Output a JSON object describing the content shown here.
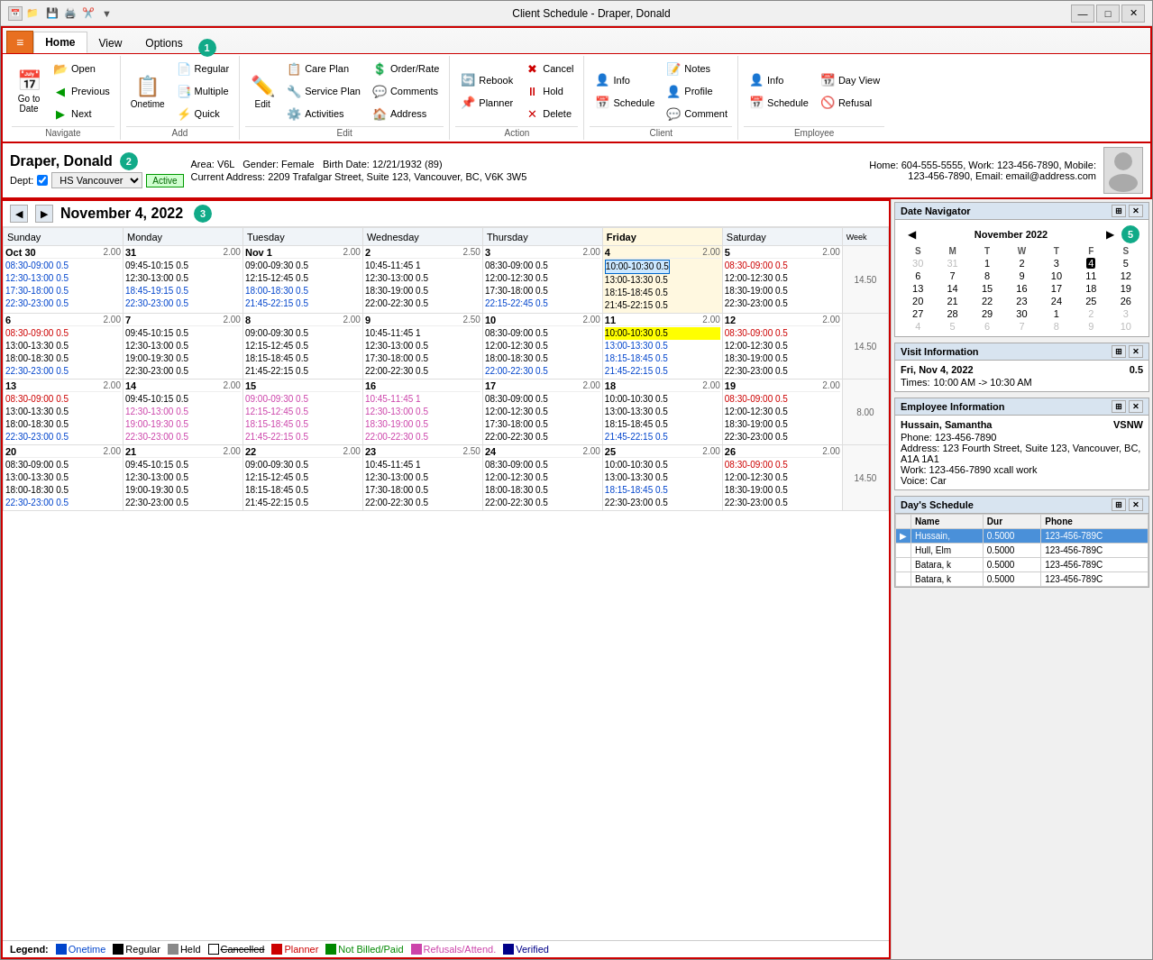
{
  "window": {
    "title": "Client Schedule - Draper, Donald",
    "min_label": "—",
    "max_label": "□",
    "close_label": "✕"
  },
  "quickaccess": {
    "icons": [
      "📁",
      "💾",
      "🖨️",
      "✂️"
    ]
  },
  "ribbon": {
    "tabs": [
      "Home",
      "View",
      "Options"
    ],
    "active_tab_icon": "≡",
    "groups": {
      "navigate": {
        "label": "Navigate",
        "goto_label": "Go to\nDate",
        "open_label": "Open",
        "prev_label": "Previous",
        "next_label": "Next"
      },
      "add": {
        "label": "Add",
        "onetime_label": "Onetime",
        "regular_label": "Regular",
        "multiple_label": "Multiple",
        "quick_label": "Quick"
      },
      "edit": {
        "label": "Edit",
        "edit_label": "Edit",
        "care_plan_label": "Care Plan",
        "service_plan_label": "Service Plan",
        "activities_label": "Activities",
        "order_rate_label": "Order/Rate",
        "comments_label": "Comments",
        "address_label": "Address"
      },
      "action": {
        "label": "Action",
        "rebook_label": "Rebook",
        "planner_label": "Planner",
        "cancel_label": "Cancel",
        "hold_label": "Hold",
        "delete_label": "Delete"
      },
      "client": {
        "label": "Client",
        "info_label": "Info",
        "schedule_label": "Schedule",
        "notes_label": "Notes",
        "profile_label": "Profile",
        "comment_label": "Comment"
      },
      "employee": {
        "label": "Employee",
        "info_label": "Info",
        "schedule_label": "Schedule",
        "day_view_label": "Day View",
        "refusal_label": "Refusal"
      }
    }
  },
  "client": {
    "name": "Draper, Donald",
    "area": "Area: V6L",
    "gender": "Gender: Female",
    "birth_date": "Birth Date: 12/21/1932 (89)",
    "address": "Current Address: 2209 Trafalgar Street, Suite 123, Vancouver, BC, V6K 3W5",
    "home_phone": "Home: 604-555-5555, Work: 123-456-7890, Mobile: 123-456-7890, Email: email@address.com",
    "dept_label": "Dept:",
    "dept_value": "HS Vancouver",
    "status": "Active"
  },
  "calendar": {
    "title": "November 4, 2022",
    "badge_num": "3",
    "days_of_week": [
      "Sunday",
      "Monday",
      "Tuesday",
      "Wednesday",
      "Thursday",
      "Friday",
      "Saturday"
    ],
    "week_col": "Week",
    "weeks": [
      {
        "week_total": "14.50",
        "days": [
          {
            "num": "Oct 30",
            "total": "2.00",
            "entries": [
              "08:30-09:00 0.5",
              "12:30-13:00 0.5",
              "17:30-18:00 0.5",
              "22:30-23:00 0.5"
            ],
            "colors": [
              "blue",
              "blue",
              "blue",
              "blue"
            ]
          },
          {
            "num": "31",
            "total": "2.00",
            "entries": [
              "09:45-10:15 0.5",
              "12:30-13:00 0.5",
              "18:45-19:15 0.5",
              "22:30-23:00 0.5"
            ],
            "colors": [
              "black",
              "black",
              "blue",
              "blue"
            ]
          },
          {
            "num": "Nov 1",
            "total": "2.00",
            "entries": [
              "09:00-09:30 0.5",
              "12:15-12:45 0.5",
              "18:00-18:30 0.5",
              "21:45-22:15 0.5"
            ],
            "colors": [
              "black",
              "black",
              "blue",
              "blue"
            ]
          },
          {
            "num": "2",
            "total": "2.50",
            "entries": [
              "10:45-11:45 1",
              "12:30-13:00 0.5",
              "18:30-19:00 0.5",
              "22:00-22:30 0.5"
            ],
            "colors": [
              "black",
              "black",
              "black",
              "black"
            ]
          },
          {
            "num": "3",
            "total": "2.00",
            "entries": [
              "08:30-09:00 0.5",
              "12:00-12:30 0.5",
              "17:30-18:00 0.5",
              "22:15-22:45 0.5"
            ],
            "colors": [
              "black",
              "black",
              "black",
              "blue"
            ]
          },
          {
            "num": "4",
            "total": "2.00",
            "entries": [
              "10:00-10:30 0.5",
              "13:00-13:30 0.5",
              "18:15-18:45 0.5",
              "21:45-22:15 0.5"
            ],
            "colors": [
              "selected",
              "black",
              "black",
              "black"
            ],
            "today": true
          },
          {
            "num": "5",
            "total": "2.00",
            "entries": [
              "08:30-09:00 0.5",
              "12:00-12:30 0.5",
              "18:30-19:00 0.5",
              "22:30-23:00 0.5"
            ],
            "colors": [
              "red",
              "black",
              "black",
              "black"
            ]
          }
        ]
      },
      {
        "week_total": "14.50",
        "days": [
          {
            "num": "6",
            "total": "2.00",
            "entries": [
              "08:30-09:00 0.5",
              "13:00-13:30 0.5",
              "18:00-18:30 0.5",
              "22:30-23:00 0.5"
            ],
            "colors": [
              "red",
              "black",
              "black",
              "blue"
            ]
          },
          {
            "num": "7",
            "total": "2.00",
            "entries": [
              "09:45-10:15 0.5",
              "12:30-13:00 0.5",
              "19:00-19:30 0.5",
              "22:30-23:00 0.5"
            ],
            "colors": [
              "black",
              "black",
              "black",
              "black"
            ]
          },
          {
            "num": "8",
            "total": "2.00",
            "entries": [
              "09:00-09:30 0.5",
              "12:15-12:45 0.5",
              "18:15-18:45 0.5",
              "21:45-22:15 0.5"
            ],
            "colors": [
              "black",
              "black",
              "black",
              "black"
            ]
          },
          {
            "num": "9",
            "total": "2.50",
            "entries": [
              "10:45-11:45 1",
              "12:30-13:00 0.5",
              "17:30-18:00 0.5",
              "22:00-22:30 0.5"
            ],
            "colors": [
              "black",
              "black",
              "black",
              "black"
            ]
          },
          {
            "num": "10",
            "total": "2.00",
            "entries": [
              "08:30-09:00 0.5",
              "12:00-12:30 0.5",
              "18:00-18:30 0.5",
              "22:00-22:30 0.5"
            ],
            "colors": [
              "black",
              "black",
              "black",
              "blue"
            ]
          },
          {
            "num": "11",
            "total": "2.00",
            "entries": [
              "10:00-10:30 0.5",
              "13:00-13:30 0.5",
              "18:15-18:45 0.5",
              "21:45-22:15 0.5"
            ],
            "colors": [
              "selected_yellow",
              "blue",
              "blue",
              "blue"
            ]
          },
          {
            "num": "12",
            "total": "2.00",
            "entries": [
              "08:30-09:00 0.5",
              "12:00-12:30 0.5",
              "18:30-19:00 0.5",
              "22:30-23:00 0.5"
            ],
            "colors": [
              "red",
              "black",
              "black",
              "black"
            ]
          }
        ]
      },
      {
        "week_total": "8.00",
        "days": [
          {
            "num": "13",
            "total": "2.00",
            "entries": [
              "08:30-09:00 0.5",
              "13:00-13:30 0.5",
              "18:00-18:30 0.5",
              "22:30-23:00 0.5"
            ],
            "colors": [
              "red",
              "black",
              "black",
              "blue"
            ]
          },
          {
            "num": "14",
            "total": "2.00",
            "entries": [
              "09:45-10:15 0.5",
              "12:30-13:00 0.5",
              "19:00-19:30 0.5",
              "22:30-23:00 0.5"
            ],
            "colors": [
              "black",
              "pink",
              "pink",
              "pink"
            ]
          },
          {
            "num": "15",
            "total": "",
            "entries": [
              "09:00-09:30 0.5",
              "12:15-12:45 0.5",
              "18:15-18:45 0.5",
              "21:45-22:15 0.5"
            ],
            "colors": [
              "pink",
              "pink",
              "pink",
              "pink"
            ]
          },
          {
            "num": "16",
            "total": "",
            "entries": [
              "10:45-11:45 1",
              "12:30-13:00 0.5",
              "18:30-19:00 0.5",
              "22:00-22:30 0.5"
            ],
            "colors": [
              "pink",
              "pink",
              "pink",
              "pink"
            ]
          },
          {
            "num": "17",
            "total": "2.00",
            "entries": [
              "08:30-09:00 0.5",
              "12:00-12:30 0.5",
              "17:30-18:00 0.5",
              "22:00-22:30 0.5"
            ],
            "colors": [
              "black",
              "black",
              "black",
              "black"
            ]
          },
          {
            "num": "18",
            "total": "2.00",
            "entries": [
              "10:00-10:30 0.5",
              "13:00-13:30 0.5",
              "18:15-18:45 0.5",
              "21:45-22:15 0.5"
            ],
            "colors": [
              "black",
              "black",
              "black",
              "blue"
            ]
          },
          {
            "num": "19",
            "total": "2.00",
            "entries": [
              "08:30-09:00 0.5",
              "12:00-12:30 0.5",
              "18:30-19:00 0.5",
              "22:30-23:00 0.5"
            ],
            "colors": [
              "red",
              "black",
              "black",
              "black"
            ]
          }
        ]
      },
      {
        "week_total": "14.50",
        "days": [
          {
            "num": "20",
            "total": "2.00",
            "entries": [
              "08:30-09:00 0.5",
              "13:00-13:30 0.5",
              "18:00-18:30 0.5",
              "22:30-23:00 0.5"
            ],
            "colors": [
              "black",
              "black",
              "black",
              "blue"
            ]
          },
          {
            "num": "21",
            "total": "2.00",
            "entries": [
              "09:45-10:15 0.5",
              "12:30-13:00 0.5",
              "19:00-19:30 0.5",
              "22:30-23:00 0.5"
            ],
            "colors": [
              "black",
              "black",
              "black",
              "black"
            ]
          },
          {
            "num": "22",
            "total": "2.00",
            "entries": [
              "09:00-09:30 0.5",
              "12:15-12:45 0.5",
              "18:15-18:45 0.5",
              "21:45-22:15 0.5"
            ],
            "colors": [
              "black",
              "black",
              "black",
              "black"
            ]
          },
          {
            "num": "23",
            "total": "2.50",
            "entries": [
              "10:45-11:45 1",
              "12:30-13:00 0.5",
              "17:30-18:00 0.5",
              "22:00-22:30 0.5"
            ],
            "colors": [
              "black",
              "black",
              "black",
              "black"
            ]
          },
          {
            "num": "24",
            "total": "2.00",
            "entries": [
              "08:30-09:00 0.5",
              "12:00-12:30 0.5",
              "18:00-18:30 0.5",
              "22:00-22:30 0.5"
            ],
            "colors": [
              "black",
              "black",
              "black",
              "black"
            ]
          },
          {
            "num": "25",
            "total": "2.00",
            "entries": [
              "10:00-10:30 0.5",
              "13:00-13:30 0.5",
              "18:15-18:45 0.5",
              "22:30-23:00 0.5"
            ],
            "colors": [
              "black",
              "black",
              "blue",
              "black"
            ]
          },
          {
            "num": "26",
            "total": "2.00",
            "entries": [
              "08:30-09:00 0.5",
              "12:00-12:30 0.5",
              "18:30-19:00 0.5",
              "22:30-23:00 0.5"
            ],
            "colors": [
              "red",
              "black",
              "black",
              "black"
            ]
          }
        ]
      }
    ]
  },
  "date_navigator": {
    "title": "Date Navigator",
    "month": "November 2022",
    "days_header": [
      "S",
      "M",
      "T",
      "W",
      "T",
      "F",
      "S"
    ],
    "weeks": [
      [
        "30",
        "31",
        "1",
        "2",
        "3",
        "4",
        "5"
      ],
      [
        "6",
        "7",
        "8",
        "9",
        "10",
        "11",
        "12"
      ],
      [
        "13",
        "14",
        "15",
        "16",
        "17",
        "18",
        "19"
      ],
      [
        "20",
        "21",
        "22",
        "23",
        "24",
        "25",
        "26"
      ],
      [
        "27",
        "28",
        "29",
        "30",
        "1",
        "2",
        "3"
      ],
      [
        "4",
        "5",
        "6",
        "7",
        "8",
        "9",
        "10"
      ]
    ],
    "today": "4",
    "other_month_days": [
      "30",
      "31",
      "1",
      "2",
      "3",
      "1",
      "2",
      "3",
      "4",
      "5",
      "6",
      "7",
      "8",
      "9",
      "10"
    ],
    "badge_num": "5"
  },
  "visit_info": {
    "title": "Visit Information",
    "date": "Fri, Nov 4, 2022",
    "value": "0.5",
    "times_label": "Times:",
    "times_value": "10:00 AM -> 10:30 AM"
  },
  "employee_info": {
    "title": "Employee Information",
    "name": "Hussain, Samantha",
    "code": "VSNW",
    "phone_label": "Phone:",
    "phone_value": "123-456-7890",
    "address_label": "Address:",
    "address_value": "123 Fourth Street, Suite 123, Vancouver, BC, A1A 1A1",
    "work_label": "Work:",
    "work_value": "123-456-7890 xcall work",
    "voice_label": "Voice:",
    "voice_value": "Car"
  },
  "days_schedule": {
    "title": "Day's Schedule",
    "columns": [
      "Name",
      "Dur",
      "Phone"
    ],
    "rows": [
      {
        "name": "Hussain,",
        "dur": "0.5000",
        "phone": "123-456-789C",
        "selected": true
      },
      {
        "name": "Hull, Elm",
        "dur": "0.5000",
        "phone": "123-456-789C",
        "selected": false
      },
      {
        "name": "Batara, k",
        "dur": "0.5000",
        "phone": "123-456-789C",
        "selected": false
      },
      {
        "name": "Batara, k",
        "dur": "0.5000",
        "phone": "123-456-789C",
        "selected": false
      }
    ]
  },
  "legend": {
    "items": [
      {
        "label": "Onetime",
        "color": "#0044cc"
      },
      {
        "label": "Regular",
        "color": "#000000"
      },
      {
        "label": "Held",
        "color": "#888888"
      },
      {
        "label": "Cancelled",
        "color": "#000000",
        "strikethrough": true
      },
      {
        "label": "Planner",
        "color": "#cc0000"
      },
      {
        "label": "Not Billed/Paid",
        "color": "#008800"
      },
      {
        "label": "Refusals/Attend.",
        "color": "#cc44aa"
      },
      {
        "label": "Verified",
        "color": "#000088"
      }
    ]
  }
}
